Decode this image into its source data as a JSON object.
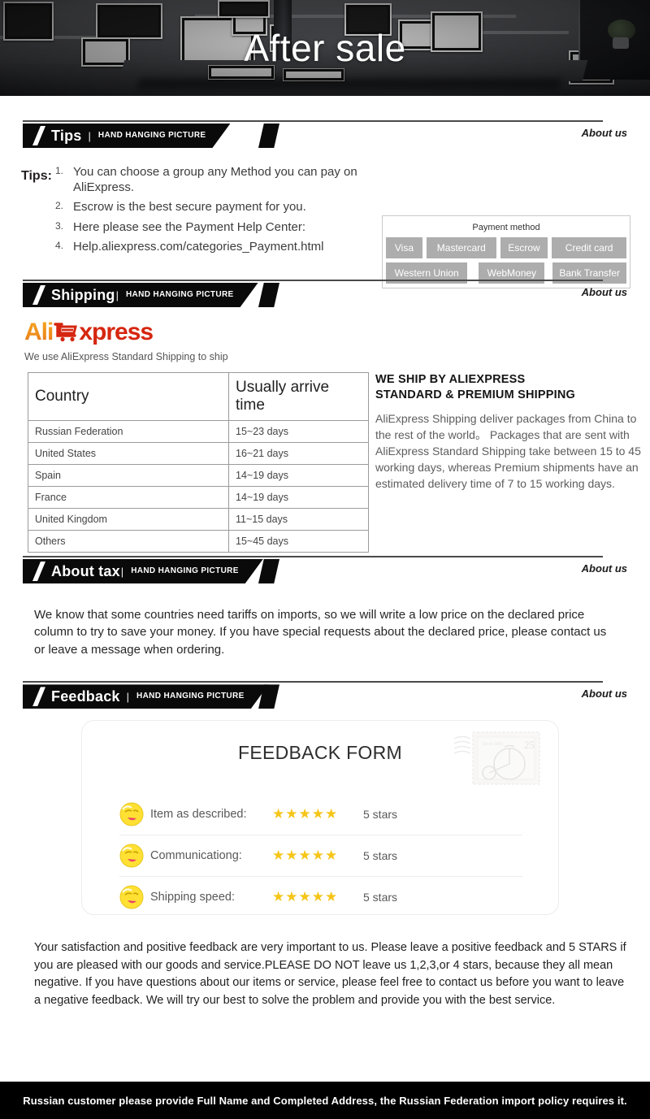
{
  "hero": {
    "title": "After sale"
  },
  "sections": {
    "tips": {
      "title": "Tips",
      "subtitle": "HAND HANGING PICTURE",
      "divider": "|",
      "about": "About us"
    },
    "shipping": {
      "title": "Shipping",
      "subtitle": "HAND HANGING PICTURE",
      "divider": "|",
      "about": "About us"
    },
    "tax": {
      "title": "About tax",
      "subtitle": "HAND HANGING PICTURE",
      "divider": "|",
      "about": "About us"
    },
    "feedback": {
      "title": "Feedback",
      "subtitle": "HAND HANGING PICTURE",
      "divider": "|",
      "about": "About us"
    }
  },
  "tips": {
    "label": "Tips:",
    "items": [
      {
        "num": "1.",
        "text": "You can choose a group any Method you can pay on AliExpress."
      },
      {
        "num": "2.",
        "text": "Escrow is the best secure payment for you."
      },
      {
        "num": "3.",
        "text": "Here please see the Payment Help Center:"
      },
      {
        "num": "4.",
        "text": "Help.aliexpress.com/categories_Payment.html"
      }
    ],
    "payment": {
      "title": "Payment method",
      "row1": [
        "Visa",
        "Mastercard",
        "Escrow",
        "Credit card"
      ],
      "row2": [
        "Western Union",
        "WebMoney",
        "Bank Transfer"
      ]
    }
  },
  "shipping": {
    "logo": {
      "part1": "Ali",
      "part2": "xpress"
    },
    "logo_caption": "We use AliExpress Standard Shipping to ship",
    "table": {
      "headers": [
        "Country",
        "Usually arrive time"
      ],
      "rows": [
        [
          "Russian Federation",
          "15~23 days"
        ],
        [
          "United States",
          "16~21 days"
        ],
        [
          "Spain",
          "14~19 days"
        ],
        [
          "France",
          "14~19 days"
        ],
        [
          "United Kingdom",
          "11~15 days"
        ],
        [
          "Others",
          "15~45 days"
        ]
      ]
    },
    "heading_line1": "WE SHIP BY ALIEXPRESS",
    "heading_line2": "STANDARD & PREMIUM SHIPPING",
    "body": "AliExpress Shipping deliver packages from China to the rest of the world。 Packages that are sent with AliExpress Standard Shipping take between 15 to 45 working days, whereas Premium shipments have an estimated delivery time of 7 to 15 working days."
  },
  "tax": {
    "body": "We know that some countries need tariffs on imports, so we will write a low price on the declared price column to try to save your money. If you have special requests about the declared price, please contact us or leave a message when ordering."
  },
  "feedback": {
    "form_title": "FEEDBACK FORM",
    "stamp_value": "25",
    "rows": [
      {
        "label": "Item as described:",
        "stars": "★★★★★",
        "count": "5 stars"
      },
      {
        "label": "Communicationg:",
        "stars": "★★★★★",
        "count": "5 stars"
      },
      {
        "label": "Shipping speed:",
        "stars": "★★★★★",
        "count": "5 stars"
      }
    ],
    "note": "Your satisfaction and positive feedback are very important to us. Please leave a positive feedback and 5 STARS if you are pleased with our goods and service.PLEASE DO NOT leave us 1,2,3,or 4 stars, because they all mean negative. If you have questions about our items or service, please feel free to contact us before you want to leave a negative feedback. We will try our best to solve the problem and provide you with the best service."
  },
  "footer": {
    "text": "Russian customer please provide Full Name and Completed Address, the Russian Federation import policy requires it."
  },
  "colors": {
    "accent_orange": "#ef8f1c",
    "accent_red": "#d6260f",
    "star_yellow": "#f5c518",
    "chip_gray": "#adadad",
    "header_black": "#0a0a0a"
  }
}
